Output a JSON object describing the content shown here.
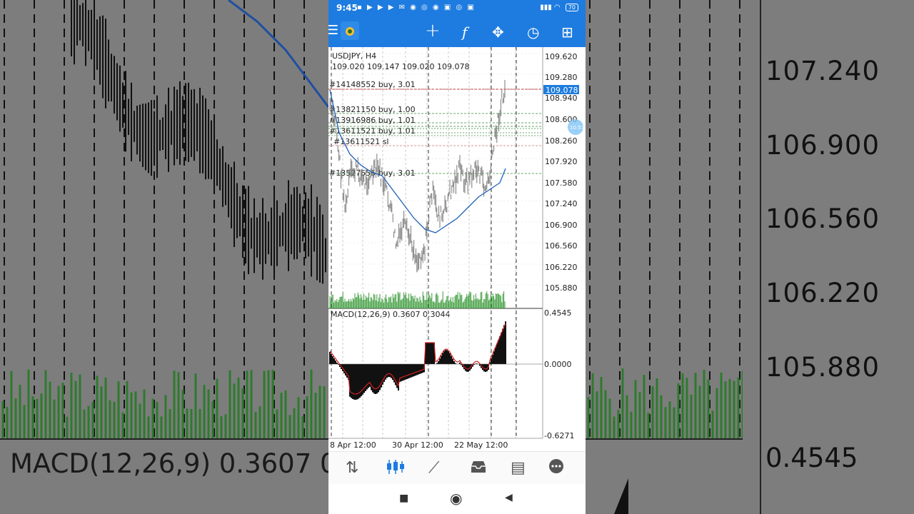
{
  "status_bar": {
    "time": "9:45",
    "battery": "70"
  },
  "chart": {
    "symbol_timeframe": "USDJPY, H4",
    "ohlc": "109.020 109.147 109.020 109.078",
    "current_price": "109.078",
    "price_ticks": [
      "109.620",
      "109.280",
      "108.940",
      "108.600",
      "108.260",
      "107.920",
      "107.580",
      "107.240",
      "106.900",
      "106.560",
      "106.220",
      "105.880"
    ],
    "orders": [
      {
        "label": "#14148552 buy, 3.01",
        "color": "#b03030"
      },
      {
        "label": "#13821150 buy, 1.00",
        "color": "#3a8a3a"
      },
      {
        "label": "#13916986 buy, 1.01",
        "color": "#3a8a3a"
      },
      {
        "label": "#13611521 buy, 1.01",
        "color": "#3a8a3a"
      },
      {
        "label": "#13611521 sl",
        "color": "#d07070"
      },
      {
        "label": "#13527555 buy, 3.01",
        "color": "#3a8a3a"
      }
    ],
    "macd_label": "MACD(12,26,9) 0.3607 0.3044",
    "macd_ticks": [
      "0.4545",
      "0.0000",
      "-0.6271"
    ],
    "time_labels": [
      "8 Apr 12:00",
      "30 Apr 12:00",
      "22 May 12:00"
    ],
    "badge": "10:51"
  },
  "background": {
    "prices": [
      "107.240",
      "106.900",
      "106.560",
      "106.220",
      "105.880"
    ],
    "macd_text": "MACD(12,26,9) 0.3607 0.",
    "macd_value": "0.4545"
  },
  "icons": {
    "menu": "☰",
    "crosshair": "+",
    "function": "f",
    "objects": "✥",
    "period": "◷",
    "new_order": "⊞",
    "tab_quotes": "⇅",
    "tab_chart": "candles",
    "tab_trade": "⟋",
    "tab_history": "inbox",
    "tab_news": "▤",
    "tab_chat": "●",
    "nav_recent": "■",
    "nav_home": "◉",
    "nav_back": "◀"
  }
}
